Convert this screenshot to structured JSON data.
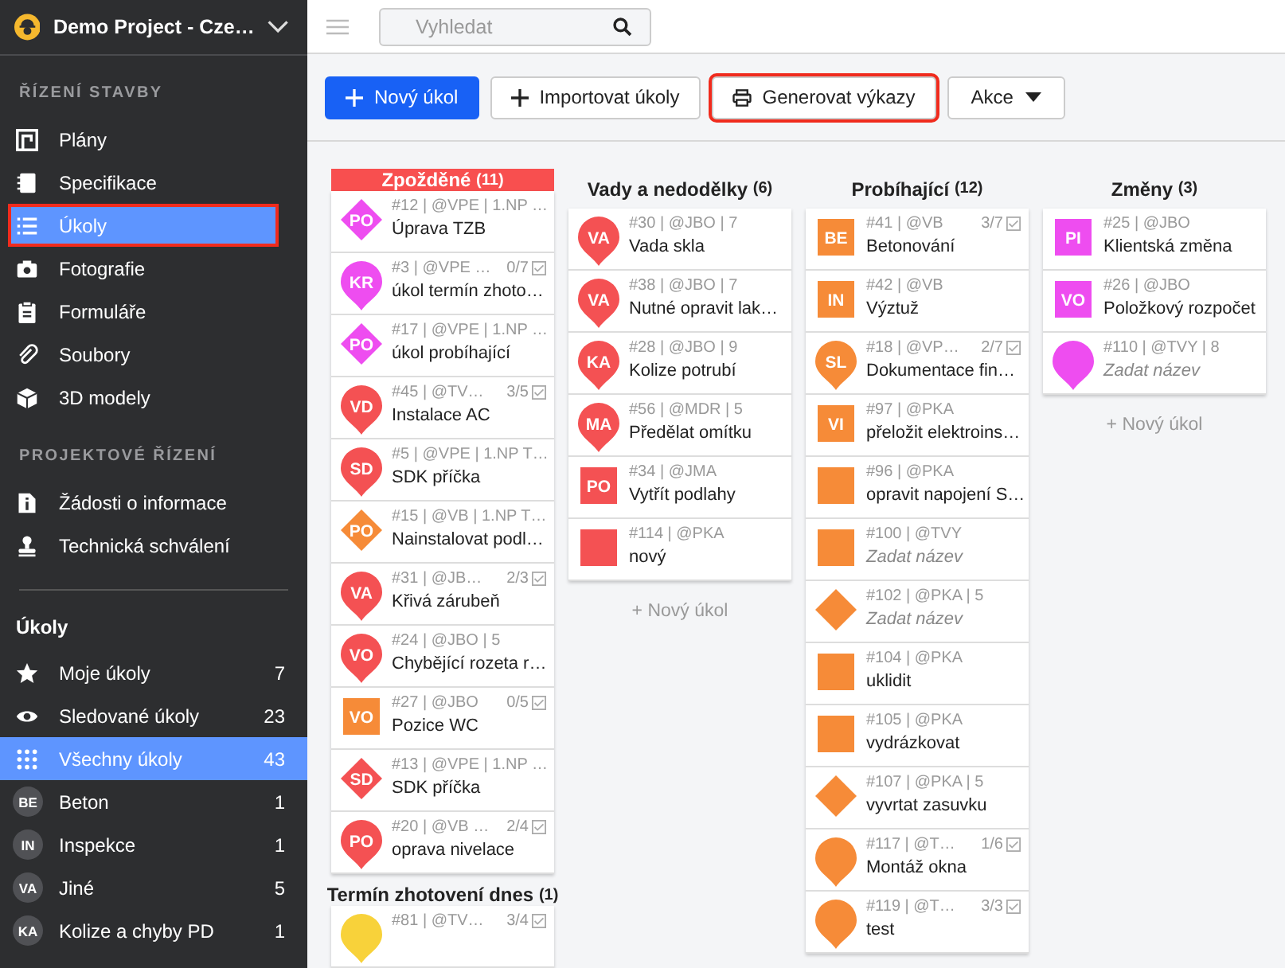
{
  "sidebar": {
    "project": "Demo Project - Cze…",
    "sections": [
      {
        "title": "ŘÍZENÍ STAVBY",
        "items": [
          {
            "label": "Plány",
            "selected": false,
            "outlined": false
          },
          {
            "label": "Specifikace",
            "selected": false,
            "outlined": false
          },
          {
            "label": "Úkoly",
            "selected": true,
            "outlined": true
          },
          {
            "label": "Fotografie",
            "selected": false,
            "outlined": false
          },
          {
            "label": "Formuláře",
            "selected": false,
            "outlined": false
          },
          {
            "label": "Soubory",
            "selected": false,
            "outlined": false
          },
          {
            "label": "3D modely",
            "selected": false,
            "outlined": false
          }
        ]
      },
      {
        "title": "PROJEKTOVÉ ŘÍZENÍ",
        "items": [
          {
            "label": "Žádosti o informace",
            "selected": false,
            "outlined": false
          },
          {
            "label": "Technická schválení",
            "selected": false,
            "outlined": false
          }
        ]
      }
    ],
    "filters_title": "Úkoly",
    "filters": [
      {
        "label": "Moje úkoly",
        "count": "7",
        "selected": false
      },
      {
        "label": "Sledované úkoly",
        "count": "23",
        "selected": false
      },
      {
        "label": "Všechny úkoly",
        "count": "43",
        "selected": true
      },
      {
        "badge": "BE",
        "label": "Beton",
        "count": "1",
        "selected": false
      },
      {
        "badge": "IN",
        "label": "Inspekce",
        "count": "1",
        "selected": false
      },
      {
        "badge": "VA",
        "label": "Jiné",
        "count": "5",
        "selected": false
      },
      {
        "badge": "KA",
        "label": "Kolize a chyby PD",
        "count": "1",
        "selected": false
      }
    ]
  },
  "search": {
    "placeholder": "Vyhledat"
  },
  "toolbar": [
    {
      "kind": "primary-add",
      "label": "Nový úkol",
      "outlined": false
    },
    {
      "kind": "plain-add",
      "label": "Importovat úkoly",
      "outlined": false
    },
    {
      "kind": "print",
      "label": "Generovat výkazy",
      "outlined": true
    },
    {
      "kind": "dropdown",
      "label": "Akce",
      "outlined": false
    }
  ],
  "columns": [
    {
      "groups": [
        {
          "title": "Zpožděné",
          "count": "(11)",
          "highlighted": true,
          "tasks": [
            {
              "marker": {
                "kind": "diamond",
                "color": "#ee4df0",
                "label": "PO"
              },
              "meta": "#12 | @VPE | 1.NP …",
              "title": "Úprava TZB"
            },
            {
              "marker": {
                "kind": "pin",
                "color": "#ee4df0",
                "label": "KR"
              },
              "meta": "#3 | @VPE …",
              "progress": "0/7",
              "title": "úkol termín zhoto…"
            },
            {
              "marker": {
                "kind": "diamond",
                "color": "#ee4df0",
                "label": "PO"
              },
              "meta": "#17 | @VPE | 1.NP …",
              "title": "úkol probíhající"
            },
            {
              "marker": {
                "kind": "pin",
                "color": "#f45153",
                "label": "VD"
              },
              "meta": "#45 | @TV…",
              "progress": "3/5",
              "title": "Instalace AC"
            },
            {
              "marker": {
                "kind": "pin",
                "color": "#f45153",
                "label": "SD"
              },
              "meta": "#5 | @VPE | 1.NP T…",
              "title": "SDK příčka"
            },
            {
              "marker": {
                "kind": "diamond",
                "color": "#f68b38",
                "label": "PO"
              },
              "meta": "#15 | @VB | 1.NP T…",
              "title": "Nainstalovat podl…"
            },
            {
              "marker": {
                "kind": "pin",
                "color": "#f45153",
                "label": "VA"
              },
              "meta": "#31 | @JB…",
              "progress": "2/3",
              "title": "Křivá zárubeň"
            },
            {
              "marker": {
                "kind": "pin",
                "color": "#f45153",
                "label": "VO"
              },
              "meta": "#24 | @JBO | 5",
              "title": "Chybějící rozeta r…"
            },
            {
              "marker": {
                "kind": "square",
                "color": "#f68b38",
                "label": "VO"
              },
              "meta": "#27 | @JBO",
              "progress": "0/5",
              "title": "Pozice WC"
            },
            {
              "marker": {
                "kind": "diamond",
                "color": "#f45153",
                "label": "SD"
              },
              "meta": "#13 | @VPE | 1.NP …",
              "title": "SDK příčka"
            },
            {
              "marker": {
                "kind": "pin",
                "color": "#f45153",
                "label": "PO"
              },
              "meta": "#20 | @VB …",
              "progress": "2/4",
              "title": "oprava nivelace"
            }
          ]
        },
        {
          "title": "Termín zhotovení dnes",
          "count": "(1)",
          "highlighted": false,
          "tasks": [
            {
              "marker": {
                "kind": "pin",
                "color": "#f8d23a"
              },
              "meta": "#81 | @TV…",
              "progress": "3/4"
            }
          ]
        }
      ]
    },
    {
      "groups": [
        {
          "title": "Vady a nedodělky",
          "count": "(6)",
          "highlighted": false,
          "tasks": [
            {
              "marker": {
                "kind": "pin",
                "color": "#f45153",
                "label": "VA"
              },
              "meta": "#30 | @JBO | 7",
              "title": "Vada skla"
            },
            {
              "marker": {
                "kind": "pin",
                "color": "#f45153",
                "label": "VA"
              },
              "meta": "#38 | @JBO | 7",
              "title": "Nutné opravit lak…"
            },
            {
              "marker": {
                "kind": "pin",
                "color": "#f45153",
                "label": "KA"
              },
              "meta": "#28 | @JBO | 9",
              "title": "Kolize potrubí"
            },
            {
              "marker": {
                "kind": "pin",
                "color": "#f45153",
                "label": "MA"
              },
              "meta": "#56 | @MDR | 5",
              "title": "Předělat omítku"
            },
            {
              "marker": {
                "kind": "square",
                "color": "#f45153",
                "label": "PO"
              },
              "meta": "#34 | @JMA",
              "title": "Vytřít podlahy"
            },
            {
              "marker": {
                "kind": "square",
                "color": "#f45153"
              },
              "meta": "#114 | @PKA",
              "title": "nový"
            }
          ]
        }
      ],
      "add_label": "+ Nový úkol"
    },
    {
      "groups": [
        {
          "title": "Probíhající",
          "count": "(12)",
          "highlighted": false,
          "tasks": [
            {
              "marker": {
                "kind": "square",
                "color": "#f68b38",
                "label": "BE"
              },
              "meta": "#41 | @VB",
              "progress": "3/7",
              "title": "Betonování"
            },
            {
              "marker": {
                "kind": "square",
                "color": "#f68b38",
                "label": "IN"
              },
              "meta": "#42 | @VB",
              "title": "Výztuž"
            },
            {
              "marker": {
                "kind": "pin",
                "color": "#f68b38",
                "label": "SL"
              },
              "meta": "#18 | @VP…",
              "progress": "2/7",
              "title": "Dokumentace fin…"
            },
            {
              "marker": {
                "kind": "square",
                "color": "#f68b38",
                "label": "VI"
              },
              "meta": "#97 | @PKA",
              "title": "přeložit elektroins…"
            },
            {
              "marker": {
                "kind": "square",
                "color": "#f68b38"
              },
              "meta": "#96 | @PKA",
              "title": "opravit napojení S…"
            },
            {
              "marker": {
                "kind": "square",
                "color": "#f68b38"
              },
              "meta": "#100 | @TVY",
              "title": "Zadat název",
              "untitled": true
            },
            {
              "marker": {
                "kind": "diamond",
                "color": "#f68b38"
              },
              "meta": "#102 | @PKA | 5",
              "title": "Zadat název",
              "untitled": true
            },
            {
              "marker": {
                "kind": "square",
                "color": "#f68b38"
              },
              "meta": "#104 | @PKA",
              "title": "uklidit"
            },
            {
              "marker": {
                "kind": "square",
                "color": "#f68b38"
              },
              "meta": "#105 | @PKA",
              "title": "vydrázkovat"
            },
            {
              "marker": {
                "kind": "diamond",
                "color": "#f68b38"
              },
              "meta": "#107 | @PKA | 5",
              "title": "vyvrtat zasuvku"
            },
            {
              "marker": {
                "kind": "pin",
                "color": "#f68b38"
              },
              "meta": "#117 | @T…",
              "progress": "1/6",
              "title": "Montáž okna"
            },
            {
              "marker": {
                "kind": "pin",
                "color": "#f68b38"
              },
              "meta": "#119 | @T…",
              "progress": "3/3",
              "title": "test"
            }
          ]
        }
      ]
    },
    {
      "groups": [
        {
          "title": "Změny",
          "count": "(3)",
          "highlighted": false,
          "tasks": [
            {
              "marker": {
                "kind": "square",
                "color": "#ee4df0",
                "label": "PI"
              },
              "meta": "#25 | @JBO",
              "title": "Klientská změna"
            },
            {
              "marker": {
                "kind": "square",
                "color": "#ee4df0",
                "label": "VO"
              },
              "meta": "#26 | @JBO",
              "title": "Položkový rozpočet"
            },
            {
              "marker": {
                "kind": "pin",
                "color": "#ee4df0"
              },
              "meta": "#110 | @TVY | 8",
              "title": "Zadat název",
              "untitled": true
            }
          ]
        }
      ],
      "add_label": "+ Nový úkol"
    }
  ]
}
